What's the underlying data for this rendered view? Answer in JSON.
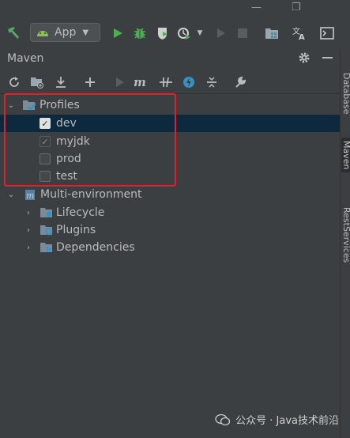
{
  "window": {
    "minimize": "—",
    "maximize": "❐"
  },
  "toolbar": {
    "run_config": {
      "label": "App",
      "icon": "android-icon"
    },
    "buttons": [
      "hammer-icon",
      "run-icon",
      "debug-icon",
      "coverage-icon",
      "profiler-icon",
      "dropdown-icon",
      "step-icon",
      "stop-icon",
      "project-structure-icon",
      "translate-icon",
      "terminal-icon"
    ]
  },
  "panel": {
    "title": "Maven",
    "settings_icon": "gear-icon",
    "hide_icon": "minimize-icon"
  },
  "maven_toolbar": [
    "reload-icon",
    "add-maven-project-icon",
    "download-icon",
    "plus-icon",
    "run-maven-icon",
    "execute-goal-icon",
    "toggle-offline-icon",
    "skip-tests-icon",
    "show-dependencies-icon",
    "settings-wrench-icon"
  ],
  "tree": {
    "profiles": {
      "label": "Profiles",
      "items": [
        {
          "label": "dev",
          "state": "checked"
        },
        {
          "label": "myjdk",
          "state": "checked-inactive"
        },
        {
          "label": "prod",
          "state": "unchecked"
        },
        {
          "label": "test",
          "state": "unchecked"
        }
      ]
    },
    "project": {
      "label": "Multi-environment",
      "children": [
        "Lifecycle",
        "Plugins",
        "Dependencies"
      ]
    }
  },
  "side_tabs": [
    "Database",
    "Maven",
    "RestServices"
  ],
  "watermark": "公众号 · Java技术前沿",
  "colors": {
    "highlight_box": "#e0202a",
    "selection": "#0d293e",
    "run_green": "#4caf50"
  }
}
